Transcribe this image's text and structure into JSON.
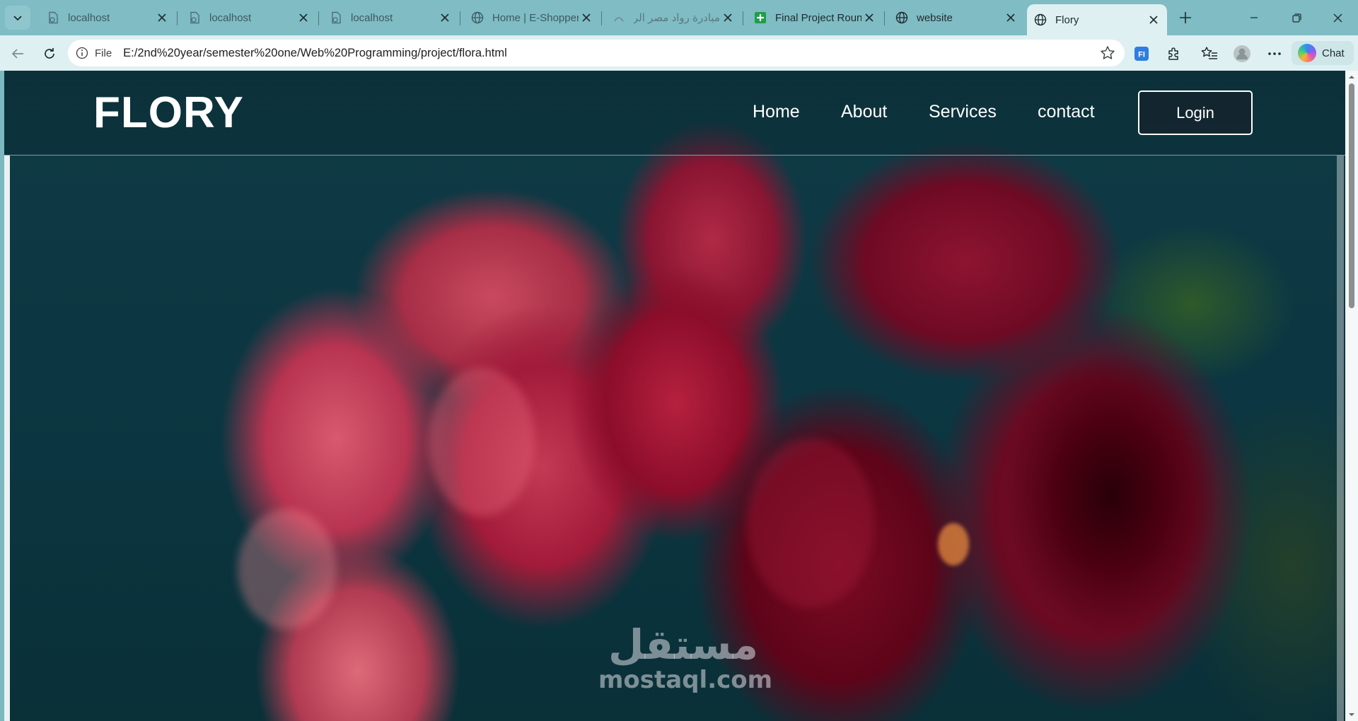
{
  "browser": {
    "tabs": [
      {
        "title": "localhost",
        "icon": "file-icon",
        "active": false
      },
      {
        "title": "localhost",
        "icon": "file-icon",
        "active": false
      },
      {
        "title": "localhost",
        "icon": "file-icon",
        "active": false
      },
      {
        "title": "Home | E-Shopper",
        "icon": "globe-icon",
        "active": false
      },
      {
        "title": "مبادرة رواد مصر الرقمية",
        "icon": "site-icon",
        "active": false
      },
      {
        "title": "Final Project Round",
        "icon": "sheets-icon",
        "active": false
      },
      {
        "title": "website",
        "icon": "globe-icon",
        "active": false
      },
      {
        "title": "Flory",
        "icon": "globe-icon",
        "active": true
      }
    ],
    "address_bar": {
      "scheme_label": "File",
      "url": "E:/2nd%20year/semester%20one/Web%20Programming/project/flora.html"
    },
    "chat_label": "Chat",
    "accent_color": "#7fbcc4"
  },
  "page": {
    "brand": "FLORY",
    "nav": {
      "home": "Home",
      "about": "About",
      "services": "Services",
      "contact": "contact"
    },
    "login_label": "Login"
  },
  "watermark": {
    "arabic": "مستقل",
    "latin": "mostaql.com"
  }
}
